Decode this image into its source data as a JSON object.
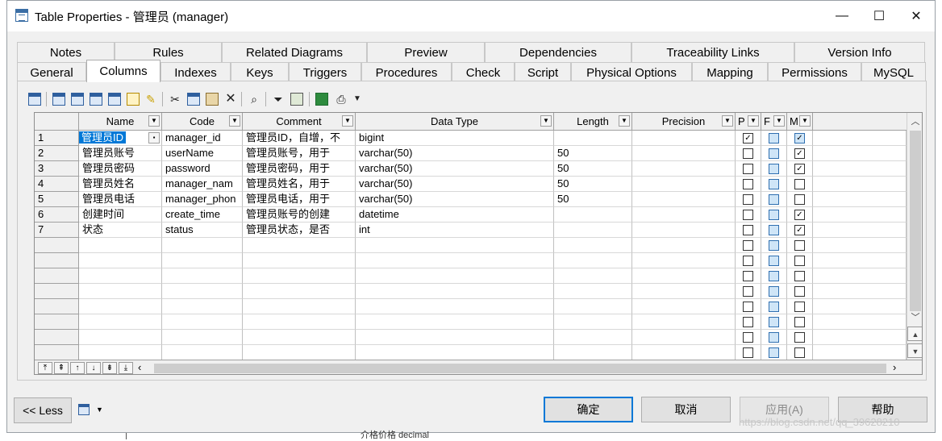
{
  "window": {
    "title": "Table Properties - 管理员 (manager)",
    "minimize": "—",
    "maximize": "☐",
    "close": "✕"
  },
  "tabs_row1": [
    "Notes",
    "Rules",
    "Related Diagrams",
    "Preview",
    "Dependencies",
    "Traceability Links",
    "Version Info"
  ],
  "tabs_row2": [
    "General",
    "Columns",
    "Indexes",
    "Keys",
    "Triggers",
    "Procedures",
    "Check",
    "Script",
    "Physical Options",
    "Mapping",
    "Permissions",
    "MySQL"
  ],
  "active_tab": "Columns",
  "grid": {
    "headers": {
      "name": "Name",
      "code": "Code",
      "comment": "Comment",
      "datatype": "Data Type",
      "length": "Length",
      "precision": "Precision",
      "p": "P",
      "f": "F",
      "m": "M"
    },
    "rows": [
      {
        "num": "1",
        "name": "管理员ID",
        "code": "manager_id",
        "comment": "管理员ID，自增，不",
        "datatype": "bigint",
        "length": "",
        "p": true,
        "f": false,
        "m": true
      },
      {
        "num": "2",
        "name": "管理员账号",
        "code": "userName",
        "comment": "管理员账号，用于",
        "datatype": "varchar(50)",
        "length": "50",
        "p": false,
        "f": false,
        "m": true
      },
      {
        "num": "3",
        "name": "管理员密码",
        "code": "password",
        "comment": "管理员密码，用于",
        "datatype": "varchar(50)",
        "length": "50",
        "p": false,
        "f": false,
        "m": true
      },
      {
        "num": "4",
        "name": "管理员姓名",
        "code": "manager_nam",
        "comment": "管理员姓名，用于",
        "datatype": "varchar(50)",
        "length": "50",
        "p": false,
        "f": false,
        "m": false
      },
      {
        "num": "5",
        "name": "管理员电话",
        "code": "manager_phon",
        "comment": "管理员电话，用于",
        "datatype": "varchar(50)",
        "length": "50",
        "p": false,
        "f": false,
        "m": false
      },
      {
        "num": "6",
        "name": "创建时间",
        "code": "create_time",
        "comment": "管理员账号的创建",
        "datatype": "datetime",
        "length": "",
        "p": false,
        "f": false,
        "m": true
      },
      {
        "num": "7",
        "name": "状态",
        "code": "status",
        "comment": "管理员状态，是否",
        "datatype": "int",
        "length": "",
        "p": false,
        "f": false,
        "m": true
      }
    ],
    "empty_rows": 8
  },
  "buttons": {
    "less": "<< Less",
    "ok": "确定",
    "cancel": "取消",
    "apply": "应用(A)",
    "help": "帮助"
  },
  "watermark": "https://blog.csdn.net/qq_39628210",
  "behind_text": "介格价格 decimal"
}
